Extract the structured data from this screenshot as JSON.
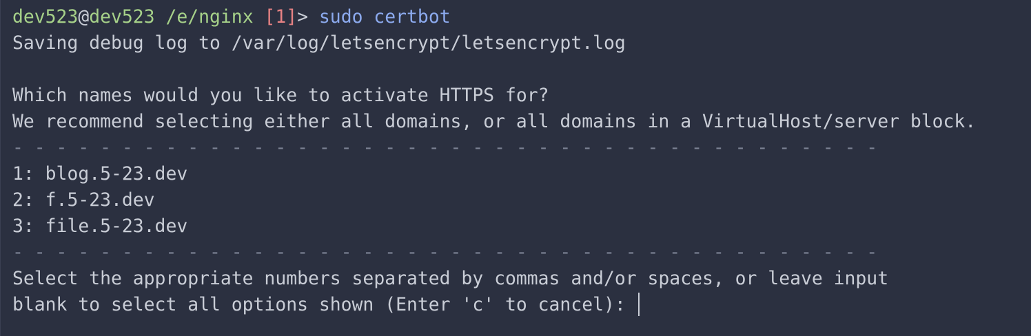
{
  "prompt": {
    "user": "dev523",
    "at": "@",
    "host": "dev523",
    "cwd": "/e/nginx",
    "status_open": "[",
    "status_code": "1",
    "status_close": "]",
    "arrow": ">",
    "command": "sudo",
    "argument": "certbot"
  },
  "output": {
    "saving_log": "Saving debug log to /var/log/letsencrypt/letsencrypt.log",
    "question": "Which names would you like to activate HTTPS for?",
    "recommendation": "We recommend selecting either all domains, or all domains in a VirtualHost/server block.",
    "divider": "- - - - - - - - - - - - - - - - - - - - - - - - - - - - - - - - - - - - - - - -",
    "options": [
      {
        "label": "1: blog.5-23.dev"
      },
      {
        "label": "2: f.5-23.dev"
      },
      {
        "label": "3: file.5-23.dev"
      }
    ],
    "select_prompt_1": "Select the appropriate numbers separated by commas and/or spaces, or leave input",
    "select_prompt_2": "blank to select all options shown (Enter 'c' to cancel): "
  },
  "input": {
    "value": ""
  },
  "colors": {
    "background": "#2b3040",
    "foreground": "#c9cdd6",
    "prompt_green": "#a6d189",
    "status_red": "#e78284",
    "command_blue": "#8caaee"
  }
}
